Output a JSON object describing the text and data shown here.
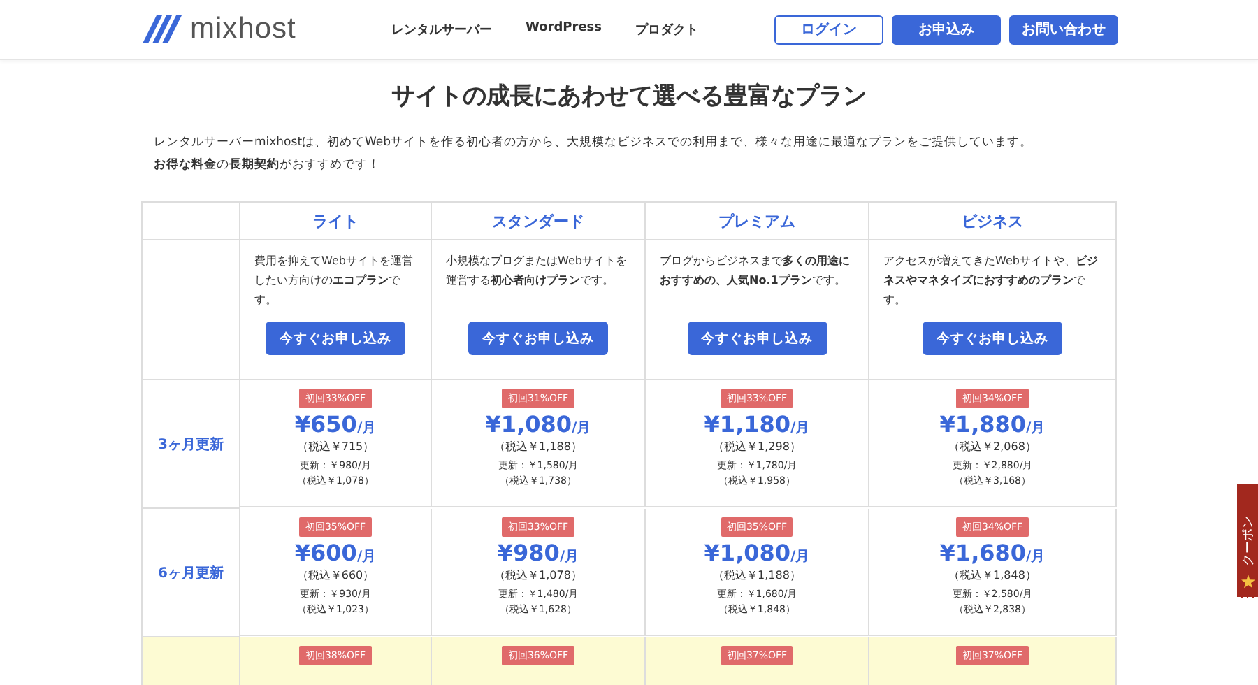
{
  "header": {
    "logo_text": "mixhost",
    "nav": [
      "レンタルサーバー",
      "WordPress",
      "プロダクト"
    ],
    "buttons": [
      {
        "label": "ログイン",
        "kind": "outline"
      },
      {
        "label": "お申込み",
        "kind": "solid"
      },
      {
        "label": "お問い合わせ",
        "kind": "solid"
      }
    ]
  },
  "title": "サイトの成長にあわせて選べる豊富なプラン",
  "intro": [
    "レンタルサーバーmixhostは、初めてWebサイトを作る初心者の方から、大規模なビジネスでの利用まで、様々な用途に最適なプランをご提供しています。",
    "**お得な料金**の**長期契約**がおすすめです！"
  ],
  "plans": [
    {
      "name": "ライト",
      "description": "費用を抑えてWebサイトを運営したい方向けの**エコプラン**です。",
      "button": "今すぐお申し込み"
    },
    {
      "name": "スタンダード",
      "description": "小規模なブログまたはWebサイトを運営する**初心者向けプラン**です。",
      "button": "今すぐお申し込み"
    },
    {
      "name": "プレミアム",
      "description": "ブログからビジネスまで**多くの用途におすすめの、人気No.1プラン**です。",
      "button": "今すぐお申し込み"
    },
    {
      "name": "ビジネス",
      "description": "アクセスが増えてきたWebサイトや、**ビジネスやマネタイズにおすすめのプラン**です。",
      "button": "今すぐお申し込み"
    }
  ],
  "rows": [
    {
      "label": "3ヶ月更新",
      "highlighted": false,
      "cells": [
        {
          "badge": "初回33%OFF",
          "price": "¥650",
          "unit": "/月",
          "tax": "（税込￥715）",
          "renewal": "更新：￥980/月",
          "renewal_tax": "（税込￥1,078）"
        },
        {
          "badge": "初回31%OFF",
          "price": "¥1,080",
          "unit": "/月",
          "tax": "（税込￥1,188）",
          "renewal": "更新：￥1,580/月",
          "renewal_tax": "（税込￥1,738）"
        },
        {
          "badge": "初回33%OFF",
          "price": "¥1,180",
          "unit": "/月",
          "tax": "（税込￥1,298）",
          "renewal": "更新：￥1,780/月",
          "renewal_tax": "（税込￥1,958）"
        },
        {
          "badge": "初回34%OFF",
          "price": "¥1,880",
          "unit": "/月",
          "tax": "（税込￥2,068）",
          "renewal": "更新：￥2,880/月",
          "renewal_tax": "（税込￥3,168）"
        }
      ]
    },
    {
      "label": "6ヶ月更新",
      "highlighted": false,
      "cells": [
        {
          "badge": "初回35%OFF",
          "price": "¥600",
          "unit": "/月",
          "tax": "（税込￥660）",
          "renewal": "更新：￥930/月",
          "renewal_tax": "（税込￥1,023）"
        },
        {
          "badge": "初回33%OFF",
          "price": "¥980",
          "unit": "/月",
          "tax": "（税込￥1,078）",
          "renewal": "更新：￥1,480/月",
          "renewal_tax": "（税込￥1,628）"
        },
        {
          "badge": "初回35%OFF",
          "price": "¥1,080",
          "unit": "/月",
          "tax": "（税込￥1,188）",
          "renewal": "更新：￥1,680/月",
          "renewal_tax": "（税込￥1,848）"
        },
        {
          "badge": "初回34%OFF",
          "price": "¥1,680",
          "unit": "/月",
          "tax": "（税込￥1,848）",
          "renewal": "更新：￥2,580/月",
          "renewal_tax": "（税込￥2,838）"
        }
      ]
    },
    {
      "highlighted": true,
      "cells": [
        {
          "badge": "初回38%OFF"
        },
        {
          "badge": "初回36%OFF"
        },
        {
          "badge": "初回37%OFF"
        },
        {
          "badge": "初回37%OFF"
        }
      ]
    }
  ],
  "coupon_tab": {
    "label": "クーポン"
  }
}
